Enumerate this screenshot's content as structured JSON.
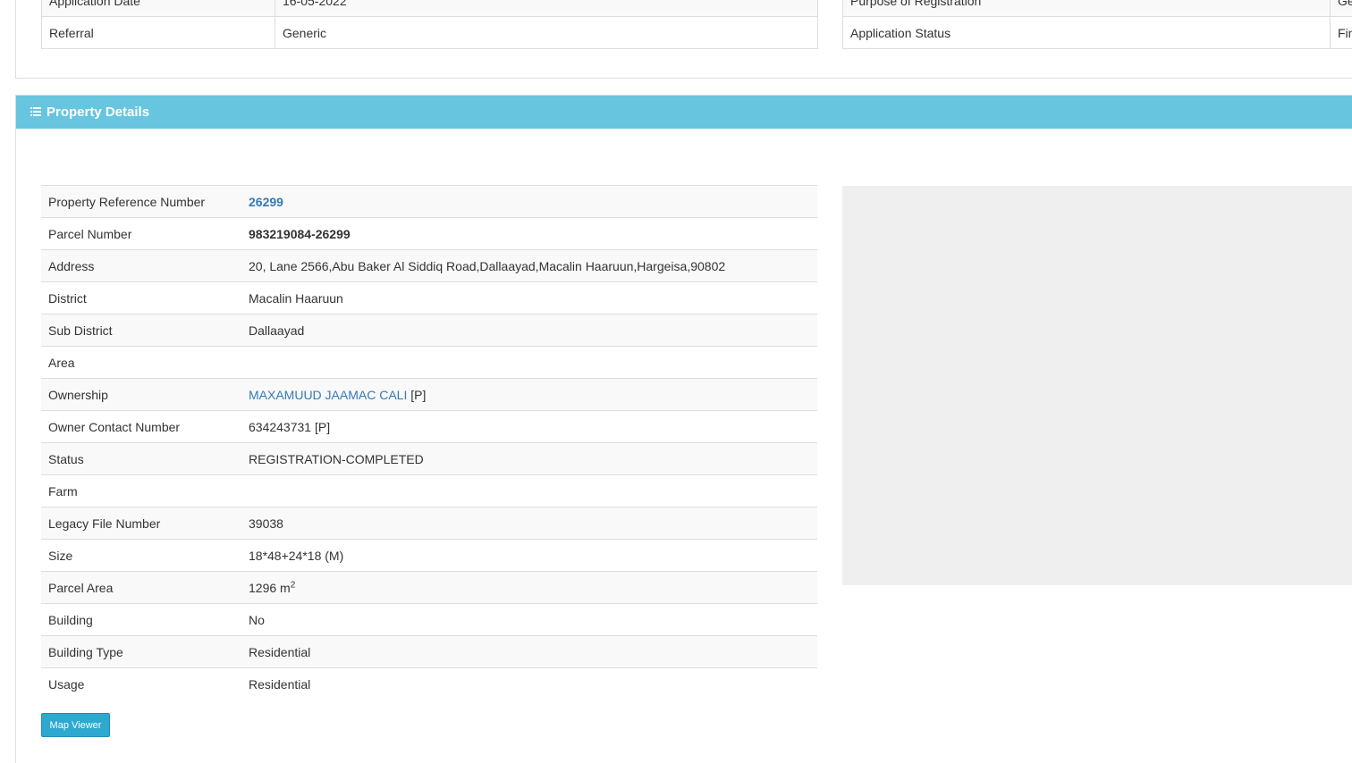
{
  "application": {
    "left_rows": [
      {
        "label": "Application Date",
        "value": "16-05-2022"
      },
      {
        "label": "Referral",
        "value": "Generic"
      }
    ],
    "right_rows": [
      {
        "label": "Purpose of Registration",
        "value": "Ge"
      },
      {
        "label": "Application Status",
        "value": "Fin"
      }
    ]
  },
  "property": {
    "title": "Property Details",
    "rows": [
      {
        "label": "Property Reference Number",
        "value": "26299"
      },
      {
        "label": "Parcel Number",
        "value": "983219084-26299"
      },
      {
        "label": "Address",
        "value": "20, Lane 2566,Abu Baker Al Siddiq Road,Dallaayad,Macalin Haaruun,Hargeisa,90802"
      },
      {
        "label": "District",
        "value": "Macalin Haaruun"
      },
      {
        "label": "Sub District",
        "value": "Dallaayad"
      },
      {
        "label": "Area",
        "value": ""
      },
      {
        "label": "Ownership",
        "value": "MAXAMUUD JAAMAC CALI",
        "suffix": " [P]"
      },
      {
        "label": "Owner Contact Number",
        "value": "634243731 [P]"
      },
      {
        "label": "Status",
        "value": "REGISTRATION-COMPLETED"
      },
      {
        "label": "Farm",
        "value": ""
      },
      {
        "label": "Legacy File Number",
        "value": "39038"
      },
      {
        "label": "Size",
        "value": "18*48+24*18 (M)"
      },
      {
        "label": "Parcel Area",
        "value": "1296 m",
        "sup": "2"
      },
      {
        "label": "Building",
        "value": "No"
      },
      {
        "label": "Building Type",
        "value": "Residential"
      },
      {
        "label": "Usage",
        "value": "Residential"
      }
    ],
    "map_button_label": "Map Viewer"
  },
  "colors": {
    "heading_bg": "#67c5e0",
    "link": "#337ab7",
    "button_bg": "#2fa8d0",
    "map_placeholder": "#efefef"
  }
}
